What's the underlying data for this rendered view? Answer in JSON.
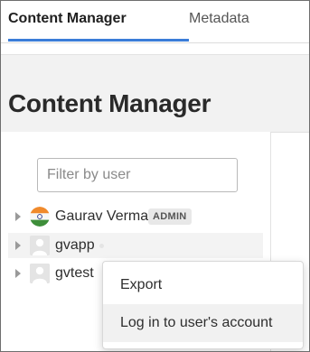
{
  "tabs": [
    {
      "label": "Content Manager",
      "active": true
    },
    {
      "label": "Metadata",
      "active": false
    }
  ],
  "page": {
    "title": "Content Manager"
  },
  "filter": {
    "placeholder": "Filter by user",
    "value": ""
  },
  "users": [
    {
      "name": "Gaurav Verma",
      "badge": "ADMIN",
      "avatar": "india-flag-icon"
    },
    {
      "name": "gvapp",
      "avatar": "user-placeholder-icon"
    },
    {
      "name": "gvtest",
      "avatar": "user-placeholder-icon"
    }
  ],
  "context_menu": {
    "items": [
      {
        "label": "Export"
      },
      {
        "label": "Log in to user's account"
      }
    ]
  },
  "colors": {
    "accent": "#3b7dd8",
    "header_bg": "#f2f2f2",
    "hover_bg": "#f3f3f3"
  }
}
